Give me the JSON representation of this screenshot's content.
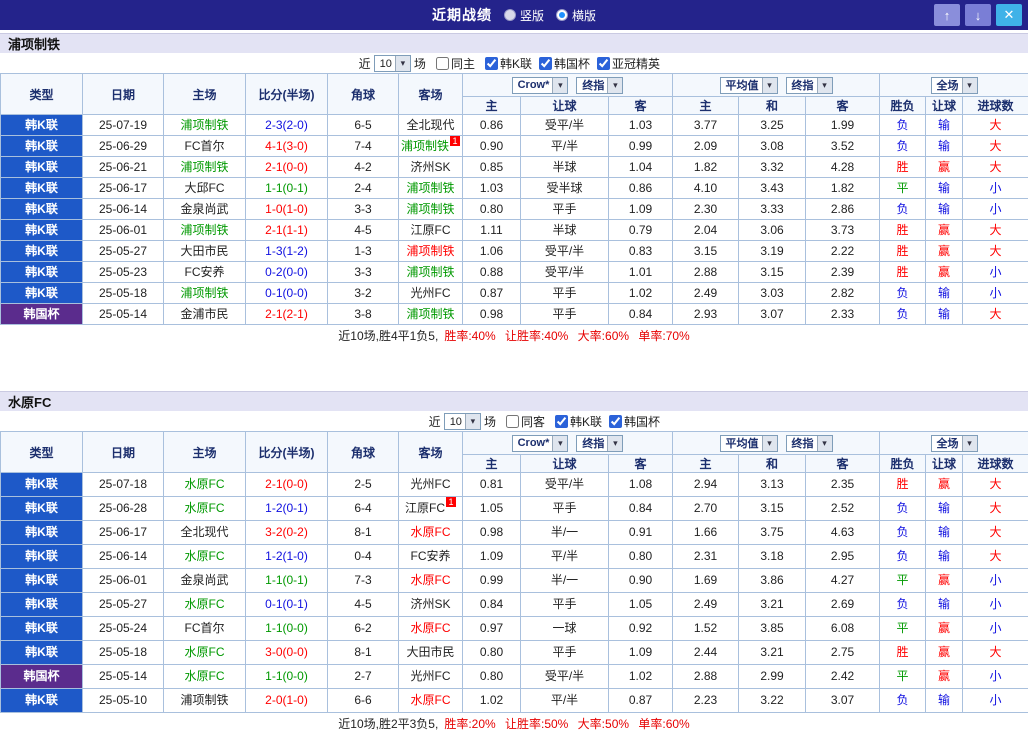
{
  "titlebar": {
    "title": "近期战绩",
    "radios": [
      {
        "label": "竖版",
        "selected": false
      },
      {
        "label": "横版",
        "selected": true
      }
    ],
    "buttons": {
      "up": "↑",
      "down": "↓",
      "close": "✕"
    }
  },
  "headers": {
    "left": [
      "类型",
      "日期",
      "主场",
      "比分(半场)",
      "角球",
      "客场"
    ],
    "book": "Crow*",
    "final": "终指",
    "average": "平均值",
    "scope": "全场",
    "sub": [
      "主",
      "让球",
      "客",
      "主",
      "和",
      "客",
      "胜负",
      "让球",
      "进球数"
    ]
  },
  "sections": [
    {
      "team": "浦项制铁",
      "filter": {
        "near": "近",
        "count": "10",
        "games": "场",
        "same": "同主",
        "same_checked": false,
        "leagues": [
          {
            "label": "韩K联",
            "checked": true
          },
          {
            "label": "韩国杯",
            "checked": true
          },
          {
            "label": "亚冠精英",
            "checked": true
          }
        ]
      },
      "rows": [
        {
          "league": "韩K联",
          "lc": "kleague",
          "date": "25-07-19",
          "home": "浦项制铁",
          "hc": "green",
          "hb": "",
          "score": "2-3(2-0)",
          "sc": "blue",
          "corner": "6-5",
          "away": "全北现代",
          "ac": "black",
          "ab": "",
          "o1": "0.86",
          "line": "受平/半",
          "o2": "1.03",
          "eh": "3.77",
          "ed": "3.25",
          "ea": "1.99",
          "r1": "负",
          "r1c": "blue",
          "r2": "输",
          "r2c": "blue",
          "r3": "大",
          "r3c": "red"
        },
        {
          "league": "韩K联",
          "lc": "kleague",
          "date": "25-06-29",
          "home": "FC首尔",
          "hc": "black",
          "hb": "",
          "score": "4-1(3-0)",
          "sc": "red",
          "corner": "7-4",
          "away": "浦项制铁",
          "ac": "green",
          "ab": "1",
          "o1": "0.90",
          "line": "平/半",
          "o2": "0.99",
          "eh": "2.09",
          "ed": "3.08",
          "ea": "3.52",
          "r1": "负",
          "r1c": "blue",
          "r2": "输",
          "r2c": "blue",
          "r3": "大",
          "r3c": "red"
        },
        {
          "league": "韩K联",
          "lc": "kleague",
          "date": "25-06-21",
          "home": "浦项制铁",
          "hc": "green",
          "hb": "",
          "score": "2-1(0-0)",
          "sc": "red",
          "corner": "4-2",
          "away": "济州SK",
          "ac": "black",
          "ab": "",
          "o1": "0.85",
          "line": "半球",
          "o2": "1.04",
          "eh": "1.82",
          "ed": "3.32",
          "ea": "4.28",
          "r1": "胜",
          "r1c": "red",
          "r2": "赢",
          "r2c": "red",
          "r3": "大",
          "r3c": "red"
        },
        {
          "league": "韩K联",
          "lc": "kleague",
          "date": "25-06-17",
          "home": "大邱FC",
          "hc": "black",
          "hb": "",
          "score": "1-1(0-1)",
          "sc": "green",
          "corner": "2-4",
          "away": "浦项制铁",
          "ac": "green",
          "ab": "",
          "o1": "1.03",
          "line": "受半球",
          "o2": "0.86",
          "eh": "4.10",
          "ed": "3.43",
          "ea": "1.82",
          "r1": "平",
          "r1c": "green",
          "r2": "输",
          "r2c": "blue",
          "r3": "小",
          "r3c": "blue"
        },
        {
          "league": "韩K联",
          "lc": "kleague",
          "date": "25-06-14",
          "home": "金泉尚武",
          "hc": "black",
          "hb": "",
          "score": "1-0(1-0)",
          "sc": "red",
          "corner": "3-3",
          "away": "浦项制铁",
          "ac": "green",
          "ab": "",
          "o1": "0.80",
          "line": "平手",
          "o2": "1.09",
          "eh": "2.30",
          "ed": "3.33",
          "ea": "2.86",
          "r1": "负",
          "r1c": "blue",
          "r2": "输",
          "r2c": "blue",
          "r3": "小",
          "r3c": "blue"
        },
        {
          "league": "韩K联",
          "lc": "kleague",
          "date": "25-06-01",
          "home": "浦项制铁",
          "hc": "green",
          "hb": "",
          "score": "2-1(1-1)",
          "sc": "red",
          "corner": "4-5",
          "away": "江原FC",
          "ac": "black",
          "ab": "",
          "o1": "1.11",
          "line": "半球",
          "o2": "0.79",
          "eh": "2.04",
          "ed": "3.06",
          "ea": "3.73",
          "r1": "胜",
          "r1c": "red",
          "r2": "赢",
          "r2c": "red",
          "r3": "大",
          "r3c": "red"
        },
        {
          "league": "韩K联",
          "lc": "kleague",
          "date": "25-05-27",
          "home": "大田市民",
          "hc": "black",
          "hb": "",
          "score": "1-3(1-2)",
          "sc": "blue",
          "corner": "1-3",
          "away": "浦项制铁",
          "ac": "red",
          "ab": "",
          "o1": "1.06",
          "line": "受平/半",
          "o2": "0.83",
          "eh": "3.15",
          "ed": "3.19",
          "ea": "2.22",
          "r1": "胜",
          "r1c": "red",
          "r2": "赢",
          "r2c": "red",
          "r3": "大",
          "r3c": "red"
        },
        {
          "league": "韩K联",
          "lc": "kleague",
          "date": "25-05-23",
          "home": "FC安养",
          "hc": "black",
          "hb": "",
          "score": "0-2(0-0)",
          "sc": "blue",
          "corner": "3-3",
          "away": "浦项制铁",
          "ac": "green",
          "ab": "",
          "o1": "0.88",
          "line": "受平/半",
          "o2": "1.01",
          "eh": "2.88",
          "ed": "3.15",
          "ea": "2.39",
          "r1": "胜",
          "r1c": "red",
          "r2": "赢",
          "r2c": "red",
          "r3": "小",
          "r3c": "blue"
        },
        {
          "league": "韩K联",
          "lc": "kleague",
          "date": "25-05-18",
          "home": "浦项制铁",
          "hc": "green",
          "hb": "",
          "score": "0-1(0-0)",
          "sc": "blue",
          "corner": "3-2",
          "away": "光州FC",
          "ac": "black",
          "ab": "",
          "o1": "0.87",
          "line": "平手",
          "o2": "1.02",
          "eh": "2.49",
          "ed": "3.03",
          "ea": "2.82",
          "r1": "负",
          "r1c": "blue",
          "r2": "输",
          "r2c": "blue",
          "r3": "小",
          "r3c": "blue"
        },
        {
          "league": "韩国杯",
          "lc": "kcup",
          "date": "25-05-14",
          "home": "金浦市民",
          "hc": "black",
          "hb": "",
          "score": "2-1(2-1)",
          "sc": "red",
          "corner": "3-8",
          "away": "浦项制铁",
          "ac": "green",
          "ab": "",
          "o1": "0.98",
          "line": "平手",
          "o2": "0.84",
          "eh": "2.93",
          "ed": "3.07",
          "ea": "2.33",
          "r1": "负",
          "r1c": "blue",
          "r2": "输",
          "r2c": "blue",
          "r3": "大",
          "r3c": "red"
        }
      ],
      "summary": {
        "record": "近10场,胜4平1负5,",
        "rates": "胜率:40% 让胜率:40% 大率:60% 单率:70%"
      }
    },
    {
      "team": "水原FC",
      "filter": {
        "near": "近",
        "count": "10",
        "games": "场",
        "same": "同客",
        "same_checked": false,
        "leagues": [
          {
            "label": "韩K联",
            "checked": true
          },
          {
            "label": "韩国杯",
            "checked": true
          }
        ]
      },
      "rows": [
        {
          "league": "韩K联",
          "lc": "kleague",
          "date": "25-07-18",
          "home": "水原FC",
          "hc": "green",
          "hb": "",
          "score": "2-1(0-0)",
          "sc": "red",
          "corner": "2-5",
          "away": "光州FC",
          "ac": "black",
          "ab": "",
          "o1": "0.81",
          "line": "受平/半",
          "o2": "1.08",
          "eh": "2.94",
          "ed": "3.13",
          "ea": "2.35",
          "r1": "胜",
          "r1c": "red",
          "r2": "赢",
          "r2c": "red",
          "r3": "大",
          "r3c": "red"
        },
        {
          "league": "韩K联",
          "lc": "kleague",
          "date": "25-06-28",
          "home": "水原FC",
          "hc": "green",
          "hb": "",
          "score": "1-2(0-1)",
          "sc": "blue",
          "corner": "6-4",
          "away": "江原FC",
          "ac": "black",
          "ab": "1",
          "o1": "1.05",
          "line": "平手",
          "o2": "0.84",
          "eh": "2.70",
          "ed": "3.15",
          "ea": "2.52",
          "r1": "负",
          "r1c": "blue",
          "r2": "输",
          "r2c": "blue",
          "r3": "大",
          "r3c": "red"
        },
        {
          "league": "韩K联",
          "lc": "kleague",
          "date": "25-06-17",
          "home": "全北现代",
          "hc": "black",
          "hb": "",
          "score": "3-2(0-2)",
          "sc": "red",
          "corner": "8-1",
          "away": "水原FC",
          "ac": "red",
          "ab": "",
          "o1": "0.98",
          "line": "半/一",
          "o2": "0.91",
          "eh": "1.66",
          "ed": "3.75",
          "ea": "4.63",
          "r1": "负",
          "r1c": "blue",
          "r2": "输",
          "r2c": "blue",
          "r3": "大",
          "r3c": "red"
        },
        {
          "league": "韩K联",
          "lc": "kleague",
          "date": "25-06-14",
          "home": "水原FC",
          "hc": "green",
          "hb": "",
          "score": "1-2(1-0)",
          "sc": "blue",
          "corner": "0-4",
          "away": "FC安养",
          "ac": "black",
          "ab": "",
          "o1": "1.09",
          "line": "平/半",
          "o2": "0.80",
          "eh": "2.31",
          "ed": "3.18",
          "ea": "2.95",
          "r1": "负",
          "r1c": "blue",
          "r2": "输",
          "r2c": "blue",
          "r3": "大",
          "r3c": "red"
        },
        {
          "league": "韩K联",
          "lc": "kleague",
          "date": "25-06-01",
          "home": "金泉尚武",
          "hc": "black",
          "hb": "",
          "score": "1-1(0-1)",
          "sc": "green",
          "corner": "7-3",
          "away": "水原FC",
          "ac": "red",
          "ab": "",
          "o1": "0.99",
          "line": "半/一",
          "o2": "0.90",
          "eh": "1.69",
          "ed": "3.86",
          "ea": "4.27",
          "r1": "平",
          "r1c": "green",
          "r2": "赢",
          "r2c": "red",
          "r3": "小",
          "r3c": "blue"
        },
        {
          "league": "韩K联",
          "lc": "kleague",
          "date": "25-05-27",
          "home": "水原FC",
          "hc": "green",
          "hb": "",
          "score": "0-1(0-1)",
          "sc": "blue",
          "corner": "4-5",
          "away": "济州SK",
          "ac": "black",
          "ab": "",
          "o1": "0.84",
          "line": "平手",
          "o2": "1.05",
          "eh": "2.49",
          "ed": "3.21",
          "ea": "2.69",
          "r1": "负",
          "r1c": "blue",
          "r2": "输",
          "r2c": "blue",
          "r3": "小",
          "r3c": "blue"
        },
        {
          "league": "韩K联",
          "lc": "kleague",
          "date": "25-05-24",
          "home": "FC首尔",
          "hc": "black",
          "hb": "",
          "score": "1-1(0-0)",
          "sc": "green",
          "corner": "6-2",
          "away": "水原FC",
          "ac": "red",
          "ab": "",
          "o1": "0.97",
          "line": "一球",
          "o2": "0.92",
          "eh": "1.52",
          "ed": "3.85",
          "ea": "6.08",
          "r1": "平",
          "r1c": "green",
          "r2": "赢",
          "r2c": "red",
          "r3": "小",
          "r3c": "blue"
        },
        {
          "league": "韩K联",
          "lc": "kleague",
          "date": "25-05-18",
          "home": "水原FC",
          "hc": "green",
          "hb": "",
          "score": "3-0(0-0)",
          "sc": "red",
          "corner": "8-1",
          "away": "大田市民",
          "ac": "black",
          "ab": "",
          "o1": "0.80",
          "line": "平手",
          "o2": "1.09",
          "eh": "2.44",
          "ed": "3.21",
          "ea": "2.75",
          "r1": "胜",
          "r1c": "red",
          "r2": "赢",
          "r2c": "red",
          "r3": "大",
          "r3c": "red"
        },
        {
          "league": "韩国杯",
          "lc": "kcup",
          "date": "25-05-14",
          "home": "水原FC",
          "hc": "green",
          "hb": "",
          "score": "1-1(0-0)",
          "sc": "green",
          "corner": "2-7",
          "away": "光州FC",
          "ac": "black",
          "ab": "",
          "o1": "0.80",
          "line": "受平/半",
          "o2": "1.02",
          "eh": "2.88",
          "ed": "2.99",
          "ea": "2.42",
          "r1": "平",
          "r1c": "green",
          "r2": "赢",
          "r2c": "red",
          "r3": "小",
          "r3c": "blue"
        },
        {
          "league": "韩K联",
          "lc": "kleague",
          "date": "25-05-10",
          "home": "浦项制铁",
          "hc": "black",
          "hb": "",
          "score": "2-0(1-0)",
          "sc": "red",
          "corner": "6-6",
          "away": "水原FC",
          "ac": "red",
          "ab": "",
          "o1": "1.02",
          "line": "平/半",
          "o2": "0.87",
          "eh": "2.23",
          "ed": "3.22",
          "ea": "3.07",
          "r1": "负",
          "r1c": "blue",
          "r2": "输",
          "r2c": "blue",
          "r3": "小",
          "r3c": "blue"
        }
      ],
      "summary": {
        "record": "近10场,胜2平3负5,",
        "rates": "胜率:20% 让胜率:50% 大率:50% 单率:60%"
      }
    }
  ]
}
